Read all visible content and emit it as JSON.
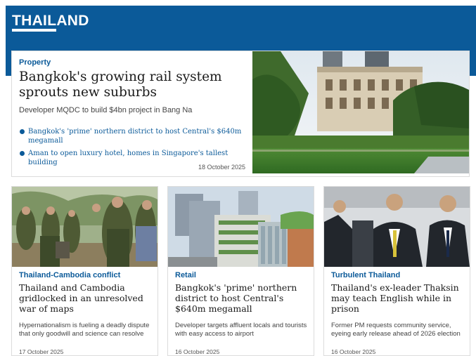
{
  "section": {
    "title": "THAILAND"
  },
  "hero": {
    "kicker": "Property",
    "headline": "Bangkok's growing rail system sprouts new suburbs",
    "summary": "Developer MQDC to build $4bn project in Bang Na",
    "related": [
      "Bangkok's 'prime' northern district to host Central's $640m megamall",
      "Aman to open luxury hotel, homes in Singapore's tallest building"
    ],
    "date": "18 October 2025"
  },
  "cards": [
    {
      "kicker": "Thailand-Cambodia conflict",
      "headline": "Thailand and Cambodia gridlocked in an unresolved war of maps",
      "summary": "Hypernationalism is fueling a deadly dispute that only goodwill and science can resolve",
      "date": "17 October 2025"
    },
    {
      "kicker": "Retail",
      "headline": "Bangkok's 'prime' northern district to host Central's $640m megamall",
      "summary": "Developer targets affluent locals and tourists with easy access to airport",
      "date": "16 October 2025"
    },
    {
      "kicker": "Turbulent Thailand",
      "headline": "Thailand's ex-leader Thaksin may teach English while in prison",
      "summary": "Former PM requests community service, eyeing early release ahead of 2026 election",
      "date": "16 October 2025"
    }
  ],
  "colors": {
    "brand": "#0b5a99",
    "text": "#1a1a1a",
    "muted": "#444444"
  }
}
